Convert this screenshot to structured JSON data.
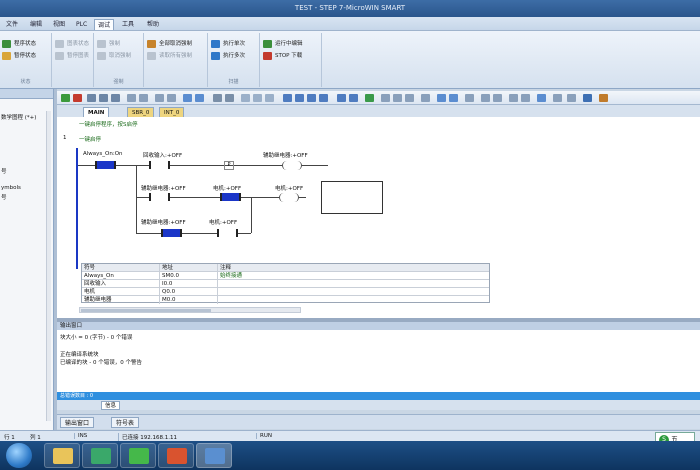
{
  "window": {
    "title": "TEST - STEP 7-MicroWIN SMART"
  },
  "menu": [
    {
      "label": "文件"
    },
    {
      "label": "编辑"
    },
    {
      "label": "视图"
    },
    {
      "label": "PLC"
    },
    {
      "label": "调试"
    },
    {
      "label": "工具"
    },
    {
      "label": "帮助"
    }
  ],
  "ribbon": {
    "groups": [
      {
        "label": "状态",
        "buttons": [
          {
            "label": "程序状态"
          },
          {
            "label": "暂停状态"
          }
        ]
      },
      {
        "label": "",
        "buttons": [
          {
            "label": "图表状态"
          },
          {
            "label": "暂停图表"
          }
        ]
      },
      {
        "label": "强制",
        "buttons": [
          {
            "label": "强制"
          },
          {
            "label": "取消强制"
          }
        ]
      },
      {
        "label": "",
        "buttons": [
          {
            "label": "全部取消强制"
          },
          {
            "label": "读取所有强制"
          }
        ]
      },
      {
        "label": "扫描",
        "buttons": [
          {
            "label": "执行单次"
          },
          {
            "label": "执行多次"
          }
        ]
      },
      {
        "label": "",
        "buttons": [
          {
            "label": "运行中编辑"
          },
          {
            "label": "STOP 下载"
          }
        ]
      }
    ]
  },
  "left_panel": {
    "items": [
      "数学图程 (*+)",
      "号",
      "",
      "ymbols",
      "号"
    ]
  },
  "tabs": [
    {
      "label": "MAIN"
    },
    {
      "label": "SBR_0"
    },
    {
      "label": "INT_0"
    }
  ],
  "ladder": {
    "block_comment": "一键启停程序，按S启停",
    "network_no": "1",
    "network_comment": "一键启停",
    "contacts": [
      {
        "label": "Always_On:On"
      },
      {
        "label": "回收输入:+OFF"
      },
      {
        "label": "P"
      },
      {
        "label": "辅助继电器:+OFF"
      },
      {
        "label": "辅助继电器:+OFF"
      },
      {
        "label": "电机:+OFF"
      },
      {
        "label": "电机:+OFF"
      },
      {
        "label": "辅助继电器:+OFF"
      },
      {
        "label": "电机:+OFF"
      }
    ]
  },
  "symbol_table": {
    "headers": [
      "符号",
      "地址",
      "注释"
    ],
    "rows": [
      [
        "Always_On",
        "SM0.0",
        "始终接通"
      ],
      [
        "回收输入",
        "I0.0",
        ""
      ],
      [
        "电机",
        "Q0.0",
        ""
      ],
      [
        "辅助继电器",
        "M0.0",
        ""
      ]
    ]
  },
  "output": {
    "title": "输出窗口",
    "lines": [
      "块大小 = 0 (字节) - 0 个错误",
      "",
      "正在编译系统块",
      "已编译的块 - 0 个错误，0 个警告"
    ],
    "selected_line": "总错误数目 : 0",
    "tabs": [
      "信息"
    ]
  },
  "bottom_tabs": [
    {
      "label": "输出窗口"
    },
    {
      "label": "符号表"
    }
  ],
  "statusbar": {
    "row": "行 1",
    "col": "列 1",
    "ins": "INS",
    "connected": "已连接 192.168.1.11",
    "mode": "RUN"
  },
  "ime": {
    "label": "五"
  },
  "colors": {
    "accent": "#1b36c8",
    "selection": "#2f8fdf",
    "taskbar": "#1d4f86"
  }
}
